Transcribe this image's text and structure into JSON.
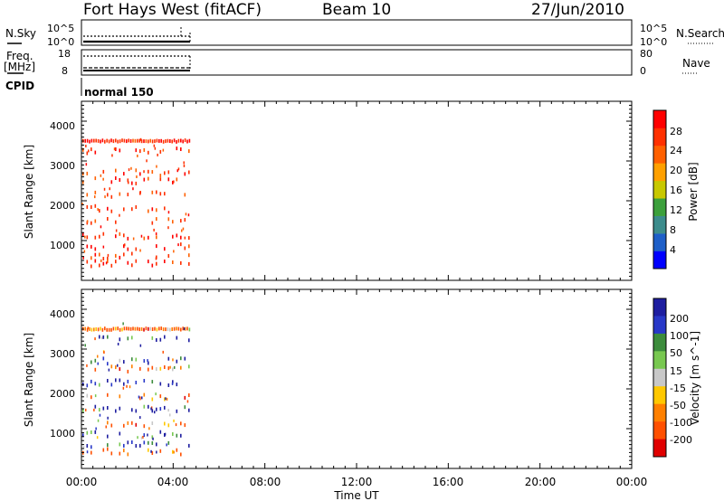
{
  "header": {
    "station": "Fort Hays West (fitACF)",
    "beam": "Beam 10",
    "date": "27/Jun/2010"
  },
  "params": {
    "nsky_label": "N.Sky",
    "nsky_ticks": [
      "10^5",
      "10^0"
    ],
    "nsky_right_ticks": [
      "10^5",
      "10^0"
    ],
    "nsearch_label": "N.Search",
    "freq_label_1": "Freq.",
    "freq_label_2": "[MHz]",
    "freq_ticks": [
      "18",
      "8"
    ],
    "nave_label": "Nave",
    "nave_ticks": [
      "80",
      "0"
    ],
    "cpid_label": "CPID",
    "cpid_value": "normal 150"
  },
  "colors": {
    "power": [
      "#0000ff",
      "#1e5fc8",
      "#3c8c8c",
      "#3ca03c",
      "#c8c800",
      "#ffa000",
      "#ff6000",
      "#ff3000",
      "#ff0000"
    ],
    "velocity": [
      "#1e1ea0",
      "#2838c8",
      "#3c8c3c",
      "#78c850",
      "#c8c8c8",
      "#ffc800",
      "#ff8000",
      "#ff5000",
      "#e00000"
    ]
  },
  "chart_data": [
    {
      "type": "scatter",
      "panel": "power",
      "ylabel": "Slant Range [km]",
      "yticks": [
        "1000",
        "2000",
        "3000",
        "4000"
      ],
      "ylim": [
        0,
        4500
      ],
      "xlim": [
        "00:00",
        "24:00"
      ],
      "data_extent_x": [
        "00:00",
        "04:45"
      ],
      "colorbar_label": "Power [dB]",
      "colorbar_ticks": [
        "4",
        "8",
        "12",
        "16",
        "20",
        "24",
        "28"
      ],
      "colorbar_range": [
        0,
        32
      ],
      "range_bands_km": [
        {
          "range": 3500,
          "value": 28
        },
        {
          "range": 3250,
          "value": 27
        },
        {
          "range": 2700,
          "value": 26
        },
        {
          "range": 2500,
          "value": 27
        },
        {
          "range": 2150,
          "value": 25
        },
        {
          "range": 1800,
          "value": 26
        },
        {
          "range": 1500,
          "value": 26
        },
        {
          "range": 1100,
          "value": 27
        },
        {
          "range": 850,
          "value": 27
        },
        {
          "range": 600,
          "value": 26
        },
        {
          "range": 420,
          "value": 27
        }
      ]
    },
    {
      "type": "scatter",
      "panel": "velocity",
      "ylabel": "Slant Range [km]",
      "yticks": [
        "1000",
        "2000",
        "3000",
        "4000"
      ],
      "ylim": [
        0,
        4500
      ],
      "xlim": [
        "00:00",
        "24:00"
      ],
      "data_extent_x": [
        "00:00",
        "04:45"
      ],
      "colorbar_label": "Velocity [m s^-1]",
      "colorbar_ticks": [
        "200",
        "100",
        "50",
        "15",
        "-15",
        "-50",
        "-100",
        "-200"
      ],
      "range_bands_km": [
        {
          "range": 3500,
          "value": -150
        },
        {
          "range": 3250,
          "value": 150
        },
        {
          "range": 2700,
          "value": 150
        },
        {
          "range": 2500,
          "value": -150
        },
        {
          "range": 2150,
          "value": 150
        },
        {
          "range": 1800,
          "value": -150
        },
        {
          "range": 1500,
          "value": 150
        },
        {
          "range": 1100,
          "value": -150
        },
        {
          "range": 850,
          "value": 150
        },
        {
          "range": 600,
          "value": 150
        },
        {
          "range": 420,
          "value": -150
        }
      ],
      "xlabel": "Time UT",
      "xticks": [
        "00:00",
        "04:00",
        "08:00",
        "12:00",
        "16:00",
        "20:00",
        "00:00"
      ]
    }
  ]
}
